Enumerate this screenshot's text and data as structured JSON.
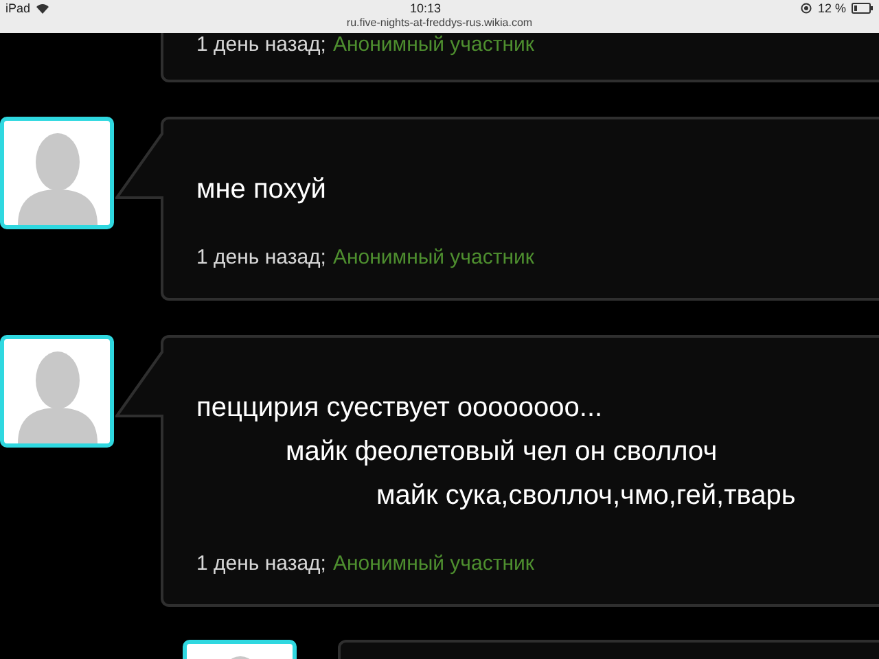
{
  "status_bar": {
    "device": "iPad",
    "time": "10:13",
    "battery": "12 %",
    "url": "ru.five-nights-at-freddys-rus.wikia.com"
  },
  "comments": [
    {
      "partial": true,
      "age": "1 день назад;",
      "author": "Анонимный участник"
    },
    {
      "partial": false,
      "lines": [
        "мне похуй"
      ],
      "age": "1 день назад;",
      "author": "Анонимный участник"
    },
    {
      "partial": false,
      "lines": [
        "пеццирия суествует оооооооо...",
        "майк феолетовый чел он своллоч",
        "майк сука,своллоч,чмо,гей,тварь"
      ],
      "age": "1 день назад;",
      "author": "Анонимный участник"
    }
  ]
}
